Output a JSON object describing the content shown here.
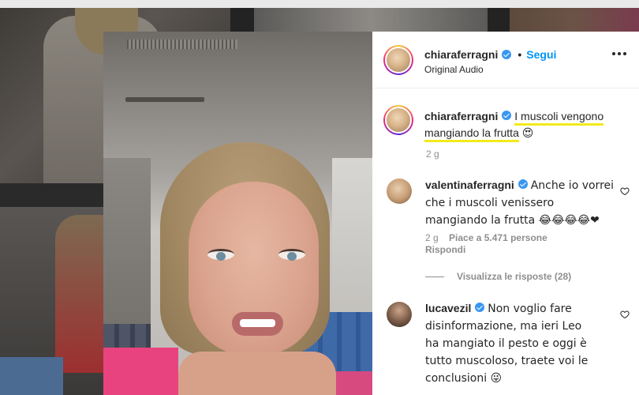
{
  "post": {
    "username": "chiaraferragni",
    "follow_label": "Segui",
    "audio": "Original Audio",
    "separator": "•"
  },
  "caption": {
    "username": "chiaraferragni",
    "text_part1": "I muscoli vengono",
    "text_part2": "mangiando la frutta",
    "emoji": "😍",
    "time": "2 g"
  },
  "comments": [
    {
      "username": "valentinaferragni",
      "text": "Anche io vorrei che i muscoli venissero mangiando la frutta 😂😂😂😂❤",
      "time": "2 g",
      "likes": "Piace a 5.471 persone",
      "reply": "Rispondi",
      "view_replies": "Visualizza le risposte (28)"
    },
    {
      "username": "lucavezil",
      "text": "Non voglio fare disinformazione, ma ieri Leo ha mangiato il pesto e oggi è tutto muscoloso, traete voi le conclusioni 😜"
    }
  ],
  "colors": {
    "accent": "#0095f6",
    "verified": "#3897f0",
    "highlight": "#f2ea1c",
    "muted": "#8e8e8e"
  }
}
